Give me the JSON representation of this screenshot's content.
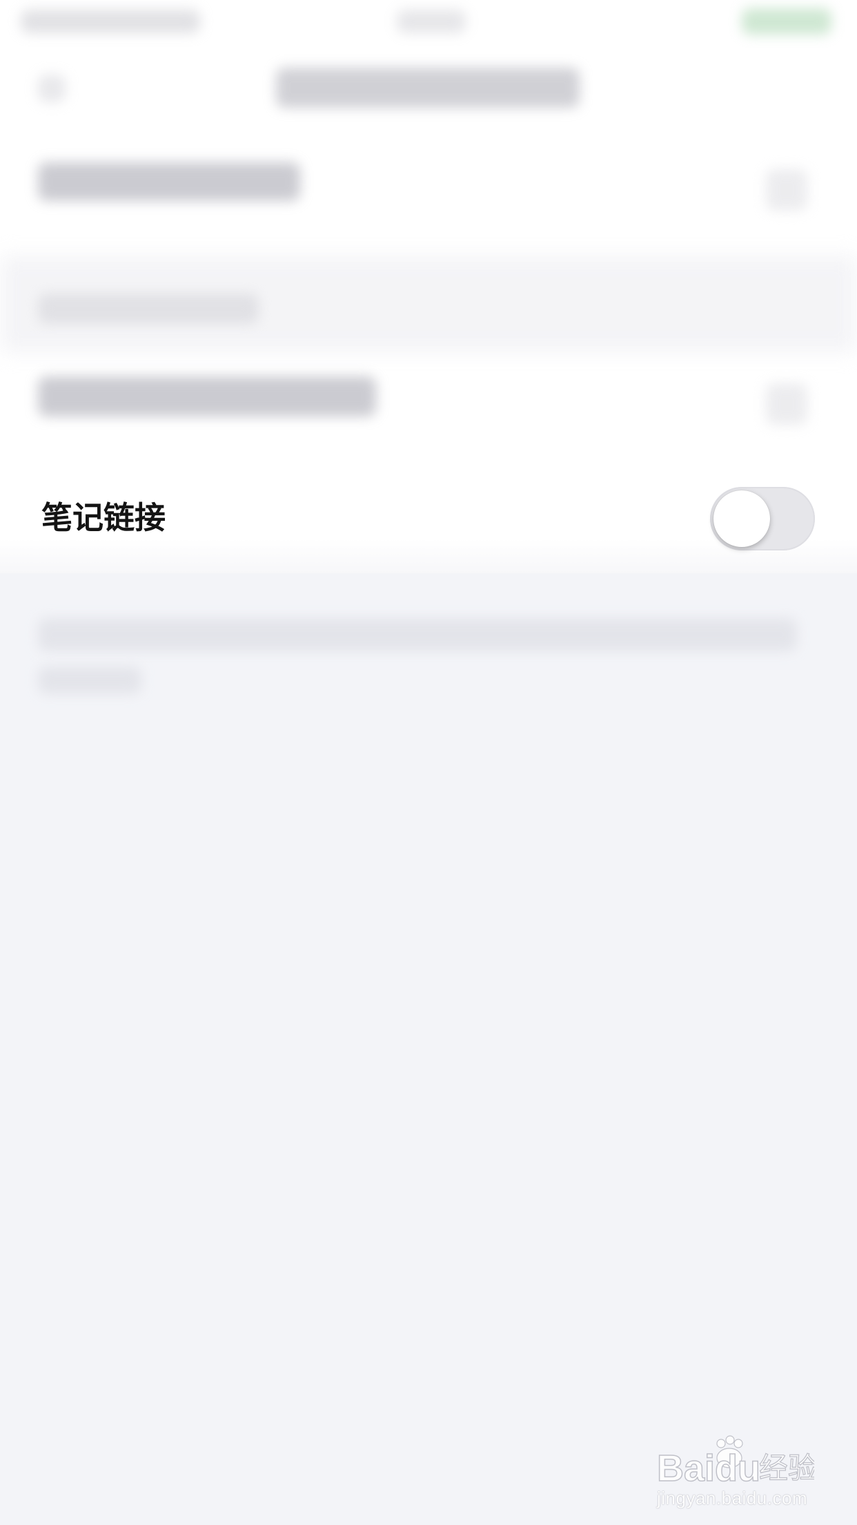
{
  "settings": {
    "note_link_label": "笔记链接",
    "note_link_enabled": false
  },
  "watermark": {
    "brand_text": "Baidu经验",
    "url": "jingyan.baidu.com"
  },
  "colors": {
    "background": "#f3f4f8",
    "sheet": "#ffffff",
    "switch_off_track": "#e6e6ea",
    "label_text": "#141414"
  }
}
